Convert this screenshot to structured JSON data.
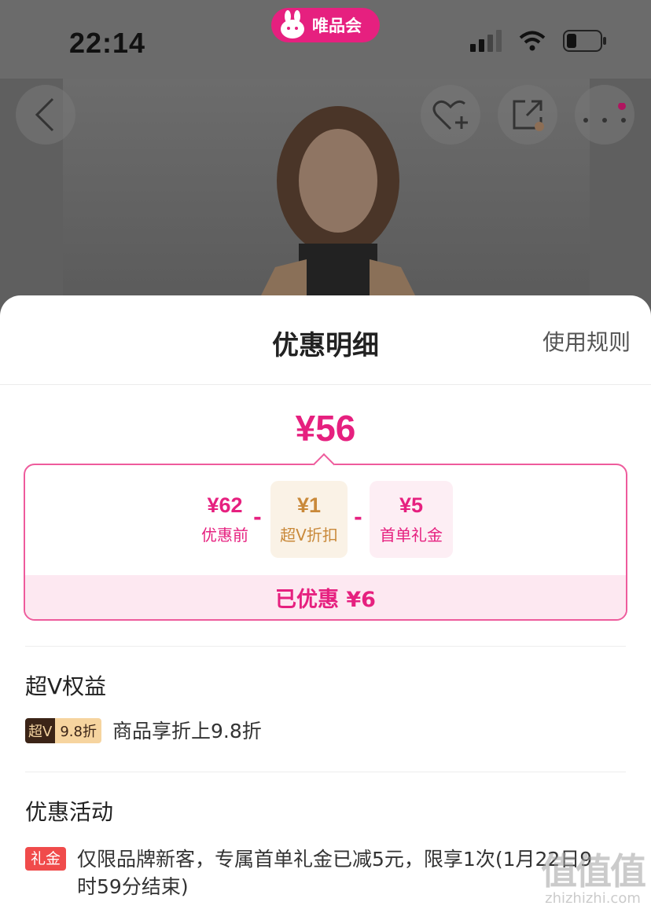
{
  "status_bar": {
    "time": "22:14",
    "app_name": "唯品会"
  },
  "nav": {
    "back": "back-icon",
    "favorite": "heart-plus-icon",
    "share": "share-icon",
    "more": "more-icon"
  },
  "sheet": {
    "title": "优惠明细",
    "rules_link": "使用规则",
    "final_price": "¥56",
    "breakdown": {
      "items": [
        {
          "amount": "¥62",
          "label": "优惠前"
        },
        {
          "amount": "¥1",
          "label": "超V折扣"
        },
        {
          "amount": "¥5",
          "label": "首单礼金"
        }
      ],
      "operator": "-",
      "saved_text": "已优惠 ¥6"
    },
    "svip_section": {
      "title": "超V权益",
      "badge_left": "超V",
      "badge_right": "9.8折",
      "text": "商品享折上9.8折"
    },
    "promo_section": {
      "title": "优惠活动",
      "tag": "礼金",
      "text": "仅限品牌新客，专属首单礼金已减5元，限享1次(1月22日9时59分结束)"
    }
  },
  "watermark": {
    "big": "值值值",
    "small": "zhizhizhi.com"
  },
  "colors": {
    "accent": "#e6207f",
    "gold": "#c9893a",
    "tag_red": "#f04b4b"
  }
}
